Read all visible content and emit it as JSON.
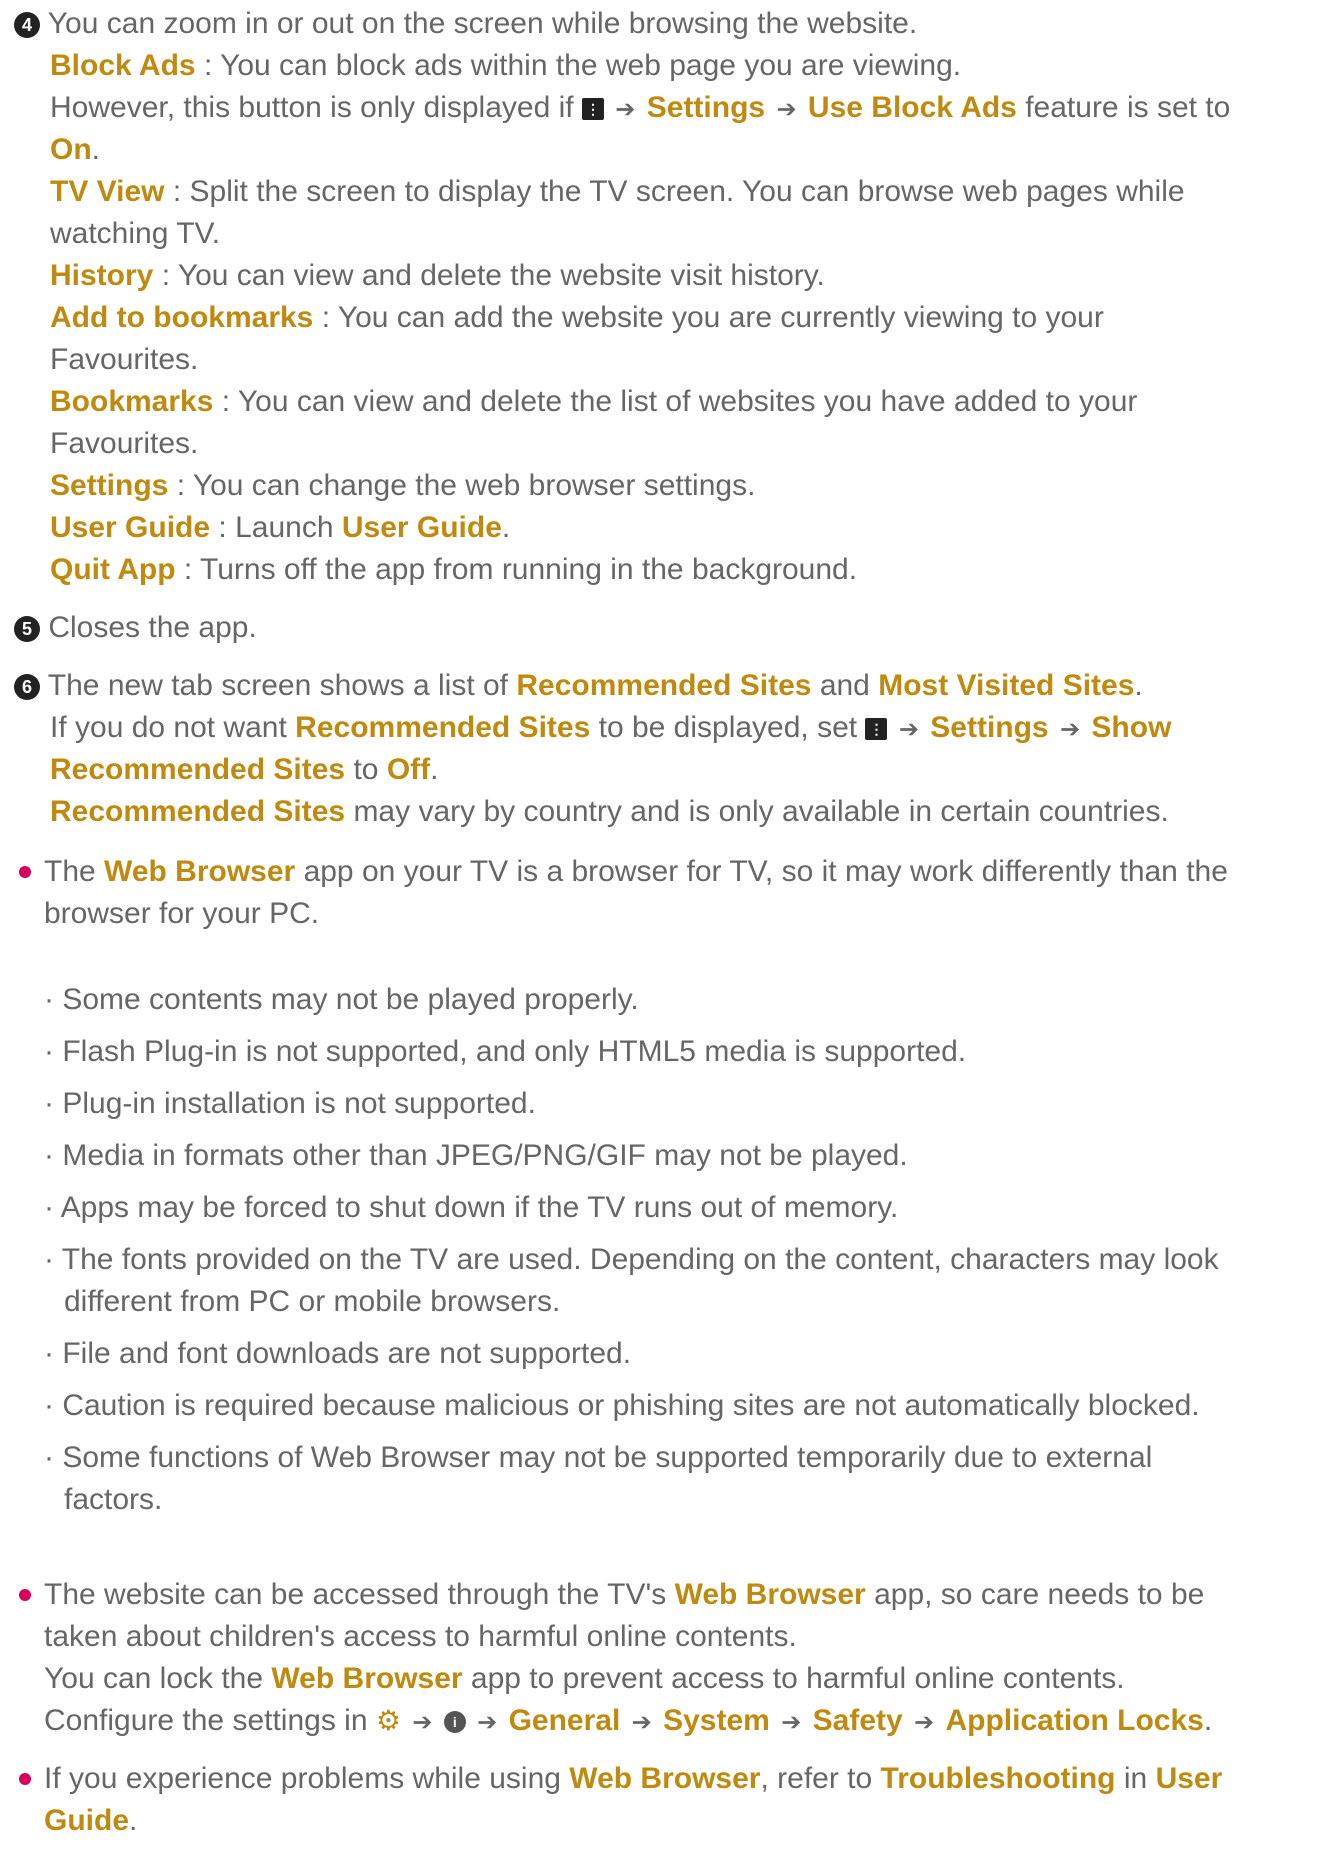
{
  "item4": {
    "number": "4",
    "intro": "You can zoom in or out on the screen while browsing the website.",
    "block_ads": {
      "term": "Block Ads",
      "desc": ": You can block ads within the web page you are viewing.",
      "note_a": "However, this button is only displayed if",
      "settings": "Settings",
      "use_block_ads": "Use Block Ads",
      "note_b": "feature is set to",
      "on": "On",
      "period": "."
    },
    "tv_view": {
      "term": "TV View",
      "desc_1": ": Split the screen to display the TV screen. You can browse web pages while",
      "desc_2": "watching TV."
    },
    "history": {
      "term": "History",
      "desc": ": You can view and delete the website visit history."
    },
    "add_bookmarks": {
      "term": "Add to bookmarks",
      "desc_1": ": You can add the website you are currently viewing to your",
      "desc_2": "Favourites."
    },
    "bookmarks": {
      "term": "Bookmarks",
      "desc_1": ": You can view and delete the list of websites you have added to your",
      "desc_2": "Favourites."
    },
    "settings": {
      "term": "Settings",
      "desc": ": You can change the web browser settings."
    },
    "user_guide": {
      "term": "User Guide",
      "desc": ": Launch",
      "link": "User Guide",
      "period": "."
    },
    "quit_app": {
      "term": "Quit App",
      "desc": ": Turns off the app from running in the background."
    }
  },
  "item5": {
    "number": "5",
    "text": "Closes the app."
  },
  "item6": {
    "number": "6",
    "a": "The new tab screen shows a list of",
    "recommended": "Recommended Sites",
    "and": "and",
    "most_visited": "Most Visited Sites",
    "period": ".",
    "b": "If you do not want",
    "c": "to be displayed, set",
    "settings": "Settings",
    "show": "Show",
    "to": "to",
    "off": "Off",
    "d": "may vary by country and is only available in certain countries."
  },
  "bullet1": {
    "a": "The",
    "web_browser": "Web Browser",
    "b": "app on your TV is a browser for TV, so it may work differently than the",
    "c": "browser for your PC.",
    "subitems": [
      "Some contents may not be played properly.",
      "Flash Plug-in is not supported, and only HTML5 media is supported.",
      "Plug-in installation is not supported.",
      "Media in formats other than JPEG/PNG/GIF may not be played.",
      "Apps may be forced to shut down if the TV runs out of memory.",
      "The fonts provided on the TV are used. Depending on the content, characters may look",
      "different from PC or mobile browsers.",
      "File and font downloads are not supported.",
      "Caution is required because malicious or phishing sites are not automatically blocked.",
      "Some functions of Web Browser may not be supported temporarily due to external",
      "factors."
    ]
  },
  "bullet2": {
    "a": "The website can be accessed through the TV's",
    "web_browser": "Web Browser",
    "b": "app, so care needs to be",
    "c": "taken about children's access to harmful online contents.",
    "d": "You can lock the",
    "e": "app to prevent access to harmful online contents.",
    "f": "Configure the settings in",
    "general": "General",
    "system": "System",
    "safety": "Safety",
    "locks": "Application Locks",
    "period": "."
  },
  "bullet3": {
    "a": "If you experience problems while using",
    "web_browser": "Web Browser",
    "b": ", refer to",
    "troubleshooting": "Troubleshooting",
    "in": "in",
    "user": "User",
    "guide": "Guide",
    "period": "."
  },
  "icons": {
    "menu": "menu-icon",
    "arrow": "→",
    "gear": "gear-icon",
    "info": "info-icon"
  },
  "colors": {
    "accent": "#c0890f",
    "text": "#666666",
    "bullet": "#d6005c"
  }
}
